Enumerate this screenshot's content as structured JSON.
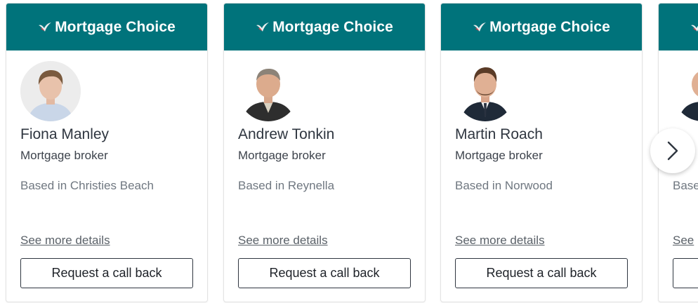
{
  "brand": {
    "name": "Mortgage Choice"
  },
  "brokers": [
    {
      "name": "Fiona Manley",
      "role": "Mortgage broker",
      "location": "Based in Christies Beach",
      "details_link": "See more details",
      "button": "Request a call back"
    },
    {
      "name": "Andrew Tonkin",
      "role": "Mortgage broker",
      "location": "Based in Reynella",
      "details_link": "See more details",
      "button": "Request a call back"
    },
    {
      "name": "Martin Roach",
      "role": "Mortgage broker",
      "location": "Based in Norwood",
      "details_link": "See more details",
      "button": "Request a call back"
    },
    {
      "name": "",
      "role": "",
      "location": "Base",
      "details_link": "See",
      "button": ""
    }
  ],
  "carousel": {
    "next_icon": "chevron-right-icon"
  },
  "colors": {
    "header": "#00737b",
    "text": "#2f3640",
    "muted": "#6f7780"
  }
}
